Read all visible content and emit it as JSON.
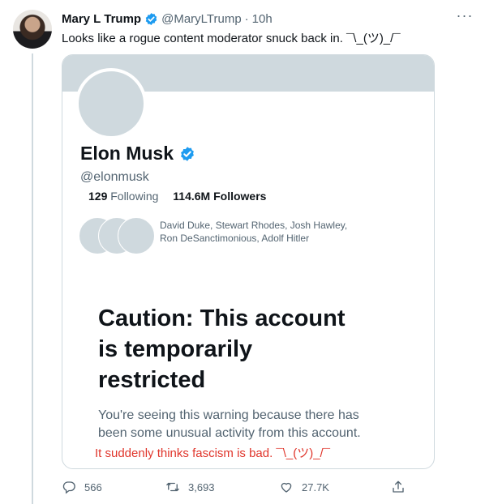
{
  "tweet": {
    "author_name": "Mary L Trump",
    "author_handle": "@MaryLTrump",
    "separator": "·",
    "timestamp": "10h",
    "text": "Looks like a rogue content moderator snuck back in. ¯\\_(ツ)_/¯",
    "more_label": "···"
  },
  "card": {
    "profile_name": "Elon Musk",
    "profile_handle": "@elonmusk",
    "following_count": "129",
    "following_label": "Following",
    "followers_text": "114.6M Followers",
    "followed_by_line1": "David Duke, Stewart Rhodes, Josh Hawley,",
    "followed_by_line2": "Ron DeSanctimonious, Adolf Hitler",
    "caution_line1": "Caution: This account",
    "caution_line2": "is temporarily",
    "caution_line3": "restricted",
    "reason_line1": "You're seeing this warning because there has",
    "reason_line2": "been some unusual activity from this account.",
    "red_note": "It suddenly thinks fascism is bad. ¯\\_(ツ)_/¯"
  },
  "actions": {
    "replies": "566",
    "retweets": "3,693",
    "likes": "27.7K"
  },
  "colors": {
    "verified_blue": "#1d9bf0",
    "muted": "#536471",
    "placeholder_gray": "#cfd9de",
    "red": "#e0352b"
  }
}
